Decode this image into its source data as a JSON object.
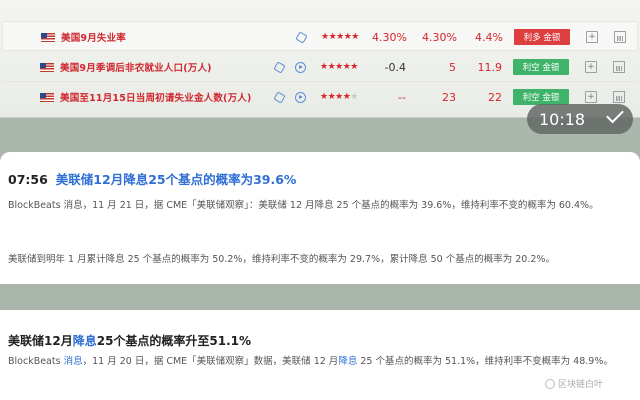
{
  "econ_table": {
    "rows": [
      {
        "name": "美国9月失业率",
        "stars": "★★★★★",
        "dim_stars": "",
        "prev": "4.30%",
        "forecast": "4.30%",
        "actual": "4.4%",
        "effect": "利多 金银",
        "effect_color": "red",
        "icons": [
          "cube-icon"
        ]
      },
      {
        "name": "美国9月季调后非农就业人口(万人)",
        "stars": "★★★★★",
        "dim_stars": "",
        "prev": "-0.4",
        "forecast": "5",
        "actual": "11.9",
        "effect": "利空 金银",
        "effect_color": "green",
        "icons": [
          "cube-icon",
          "play-icon"
        ]
      },
      {
        "name": "美国至11月15日当周初请失业金人数(万人)",
        "stars": "★★★★",
        "dim_stars": "★",
        "prev": "--",
        "forecast": "23",
        "actual": "22",
        "effect": "利空 金银",
        "effect_color": "green",
        "icons": [
          "cube-icon",
          "play-icon"
        ]
      }
    ]
  },
  "time_pill": {
    "time": "10:18"
  },
  "news1": {
    "time": "07:56",
    "headline": "美联储12月降息25个基点的概率为39.6%",
    "para1": "BlockBeats 消息，11 月 21 日，据 CME「美联储观察」：美联储 12 月降息 25 个基点的概率为 39.6%，维持利率不变的概率为 60.4%。",
    "para2": "美联储到明年 1 月累计降息 25 个基点的概率为 50.2%，维持利率不变的概率为 29.7%，累计降息 50 个基点的概率为 20.2%。"
  },
  "news2": {
    "headline_a": "美联储12月",
    "headline_hl": "降息",
    "headline_b": "25个基点的概率升至51.1%",
    "p_a": "BlockBeats ",
    "p_hl1": "消息",
    "p_b": "，11 月 20 日，据 CME「美联储观察」数据，美联储 12 月",
    "p_hl2": "降息",
    "p_c": " 25 个基点的概率为 51.1%，维持利率不变概率为 48.9%。"
  },
  "watermark": "区块链白叶",
  "colors": {
    "red": "#dd3f3f",
    "green": "#3fb36a",
    "link_blue": "#2f6fd6"
  }
}
